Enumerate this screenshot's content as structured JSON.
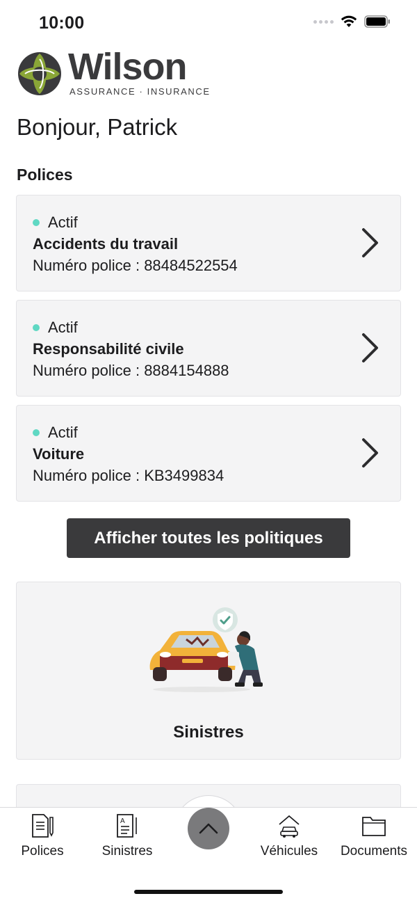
{
  "status_bar": {
    "time": "10:00"
  },
  "brand": {
    "name": "Wilson",
    "tagline": "ASSURANCE · INSURANCE"
  },
  "greeting": "Bonjour, Patrick",
  "policies_section": {
    "title": "Polices",
    "number_prefix": "Numéro police : ",
    "items": [
      {
        "status": "Actif",
        "name": "Accidents du travail",
        "number": "88484522554"
      },
      {
        "status": "Actif",
        "name": "Responsabilité civile",
        "number": "8884154888"
      },
      {
        "status": "Actif",
        "name": "Voiture",
        "number": "KB3499834"
      }
    ],
    "view_all_label": "Afficher toutes les politiques"
  },
  "claims_card": {
    "label": "Sinistres"
  },
  "tab_bar": {
    "items": [
      {
        "label": "Polices",
        "icon": "policy-document-icon"
      },
      {
        "label": "Sinistres",
        "icon": "claims-document-icon"
      },
      {
        "label": "Véhicules",
        "icon": "car-house-icon"
      },
      {
        "label": "Documents",
        "icon": "folder-icon"
      }
    ],
    "center_button_icon": "chevron-up-icon"
  },
  "colors": {
    "status_active": "#5fd8c3",
    "card_background": "#f4f4f5",
    "primary_button": "#3a3a3c",
    "logo_green": "#8aa637",
    "logo_dark": "#3a3a3c",
    "center_button": "#7a7a7c"
  }
}
